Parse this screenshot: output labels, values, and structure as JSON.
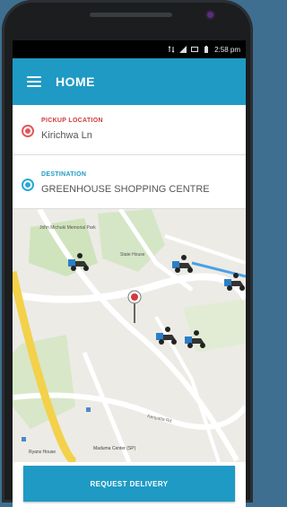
{
  "status_bar": {
    "time": "2:58 pm"
  },
  "app_bar": {
    "title": "HOME"
  },
  "pickup": {
    "label": "PICKUP LOCATION",
    "value": "Kirichwa Ln",
    "label_color": "#d23a3a",
    "dot_color": "#e15a5a"
  },
  "destination": {
    "label": "DESTINATION",
    "value": "GREENHOUSE SHOPPING CENTRE",
    "label_color": "#1f9ac4",
    "dot_color": "#29a9d6"
  },
  "map": {
    "labels": {
      "john_michuki": "John Michuki Memorial Park",
      "state_house": "State House",
      "maduma": "Maduma Center (SP)",
      "ryan_house": "Ryans House",
      "kenyatta_rd": "Kenyatta Rd"
    }
  },
  "action": {
    "request_label": "REQUEST DELIVERY"
  },
  "colors": {
    "accent": "#1f9ac4",
    "pin": "#d23a3a"
  }
}
